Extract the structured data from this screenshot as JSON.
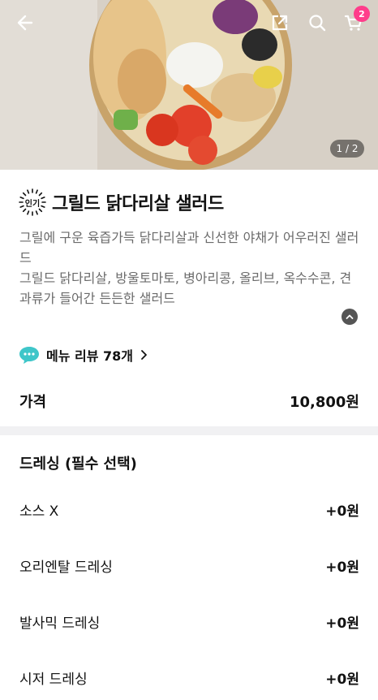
{
  "header": {
    "back_icon": "arrow-left-icon",
    "share_icon": "share-icon",
    "search_icon": "search-icon",
    "cart_icon": "cart-icon",
    "cart_count": "2"
  },
  "hero": {
    "page_indicator": "1 / 2"
  },
  "product": {
    "badge": "인기",
    "title": "그릴드 닭다리살 샐러드",
    "description": "그릴에 구운 육즙가득 닭다리살과 신선한 야채가 어우러진 샐러드\n그릴드 닭다리살, 방울토마토, 병아리콩, 올리브, 옥수수콘, 견과류가 들어간 든든한 샐러드",
    "review_label": "메뉴 리뷰 78개",
    "price_label": "가격",
    "price_value": "10,800원"
  },
  "dressing": {
    "title": "드레싱 (필수 선택)",
    "options": [
      {
        "label": "소스 X",
        "price": "+0원"
      },
      {
        "label": "오리엔탈 드레싱",
        "price": "+0원"
      },
      {
        "label": "발사믹 드레싱",
        "price": "+0원"
      },
      {
        "label": "시저 드레싱",
        "price": "+0원"
      }
    ]
  },
  "colors": {
    "badge_pink": "#ff3d8b",
    "review_icon_teal": "#3fc6c9",
    "section_divider": "#f1f1f3"
  }
}
